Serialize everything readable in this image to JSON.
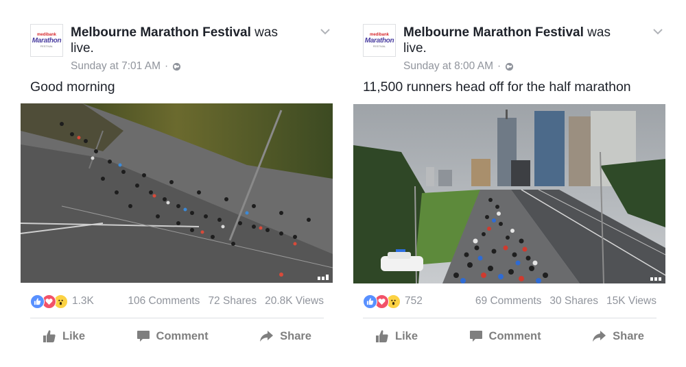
{
  "posts": [
    {
      "page_name": "Melbourne Marathon Festival",
      "status_suffix": " was live.",
      "timestamp": "Sunday at 7:01 AM",
      "separator": "·",
      "message": "Good morning",
      "avatar": {
        "top": "medibank",
        "main": "Marathon",
        "bottom": "FESTIVAL"
      },
      "reaction_count": "1.3K",
      "comments": "106 Comments",
      "shares": "72 Shares",
      "views": "20.8K Views",
      "actions": {
        "like": "Like",
        "comment": "Comment",
        "share": "Share"
      }
    },
    {
      "page_name": "Melbourne Marathon Festival",
      "status_suffix": " was live.",
      "timestamp": "Sunday at 8:00 AM",
      "separator": "·",
      "message": "11,500 runners head off for the half marathon",
      "avatar": {
        "top": "medibank",
        "main": "Marathon",
        "bottom": "FESTIVAL"
      },
      "reaction_count": "752",
      "comments": "69 Comments",
      "shares": "30 Shares",
      "views": "15K Views",
      "actions": {
        "like": "Like",
        "comment": "Comment",
        "share": "Share"
      }
    }
  ],
  "icons": [
    "chevron-down-icon",
    "globe-icon",
    "like-reaction-icon",
    "love-reaction-icon",
    "wow-reaction-icon",
    "thumbs-up-icon",
    "comment-icon",
    "share-arrow-icon"
  ],
  "colors": {
    "text": "#1d2129",
    "meta": "#90949c",
    "like_blue": "#5890ff",
    "love_red": "#f25268",
    "wow_yellow": "#fcd243",
    "action_gray": "#7f7f7f"
  }
}
